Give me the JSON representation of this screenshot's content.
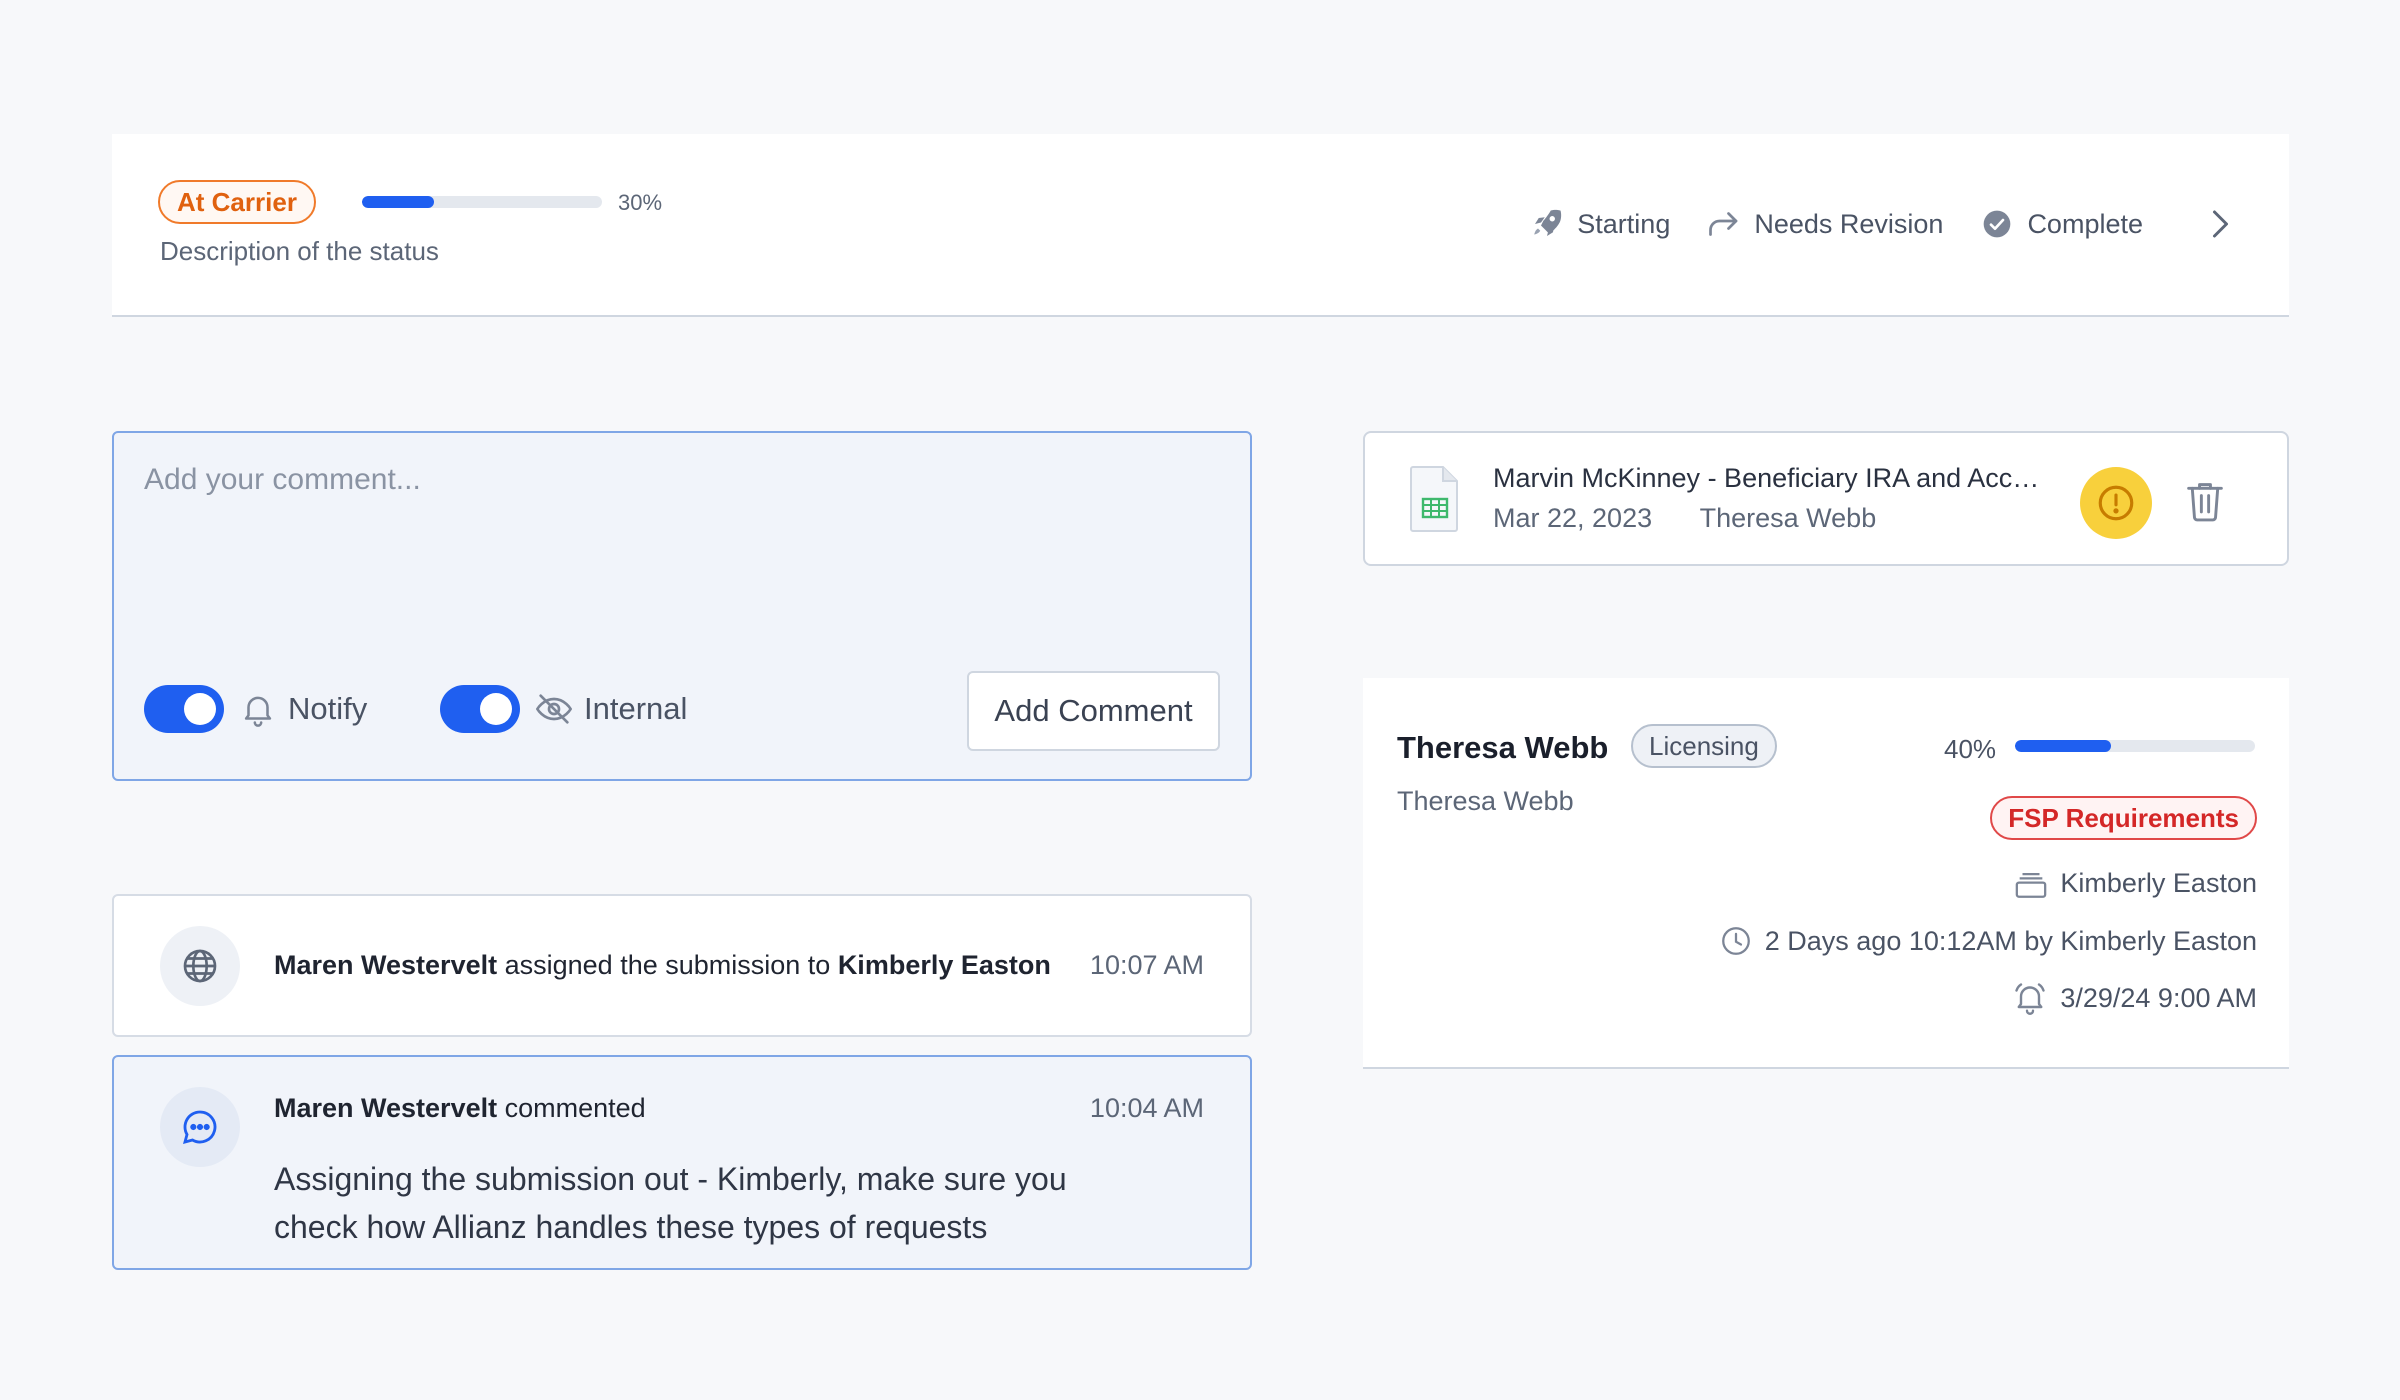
{
  "status": {
    "badge": "At Carrier",
    "progress_percent": 30,
    "progress_label": "30%",
    "description": "Description of the status",
    "steps": [
      {
        "label": "Starting",
        "icon": "rocket-icon"
      },
      {
        "label": "Needs Revision",
        "icon": "redo-arrow-icon"
      },
      {
        "label": "Complete",
        "icon": "check-circle-icon"
      }
    ],
    "next_icon": "chevron-right-icon"
  },
  "composer": {
    "placeholder": "Add your comment...",
    "notify_label": "Notify",
    "internal_label": "Internal",
    "submit_label": "Add Comment"
  },
  "feed": [
    {
      "actor": "Maren Westervelt",
      "action": "assigned the submission to",
      "target": "Kimberly Easton",
      "time": "10:07 AM",
      "icon": "globe-icon"
    },
    {
      "actor": "Maren Westervelt",
      "action": "commented",
      "time": "10:04 AM",
      "body": "Assigning the submission out - Kimberly, make sure you check how Allianz handles these types of requests",
      "icon": "chat-bubble-icon"
    }
  ],
  "document": {
    "title": "Marvin McKinney - Beneficiary IRA and Account Transfer",
    "date": "Mar 22, 2023",
    "owner": "Theresa Webb",
    "icon": "spreadsheet-file-icon"
  },
  "assignment": {
    "name": "Theresa Webb",
    "tag": "Licensing",
    "progress_percent": 40,
    "progress_label": "40%",
    "subtitle": "Theresa Webb",
    "requirement_badge": "FSP Requirements",
    "assignee": "Kimberly Easton",
    "updated": "2 Days ago 10:12AM by Kimberly Easton",
    "reminder": "3/29/24 9:00 AM"
  },
  "colors": {
    "accent": "#1f5ff0",
    "status_orange": "#e0610f",
    "warning_yellow": "#f8d03c",
    "danger_red": "#d42727"
  }
}
